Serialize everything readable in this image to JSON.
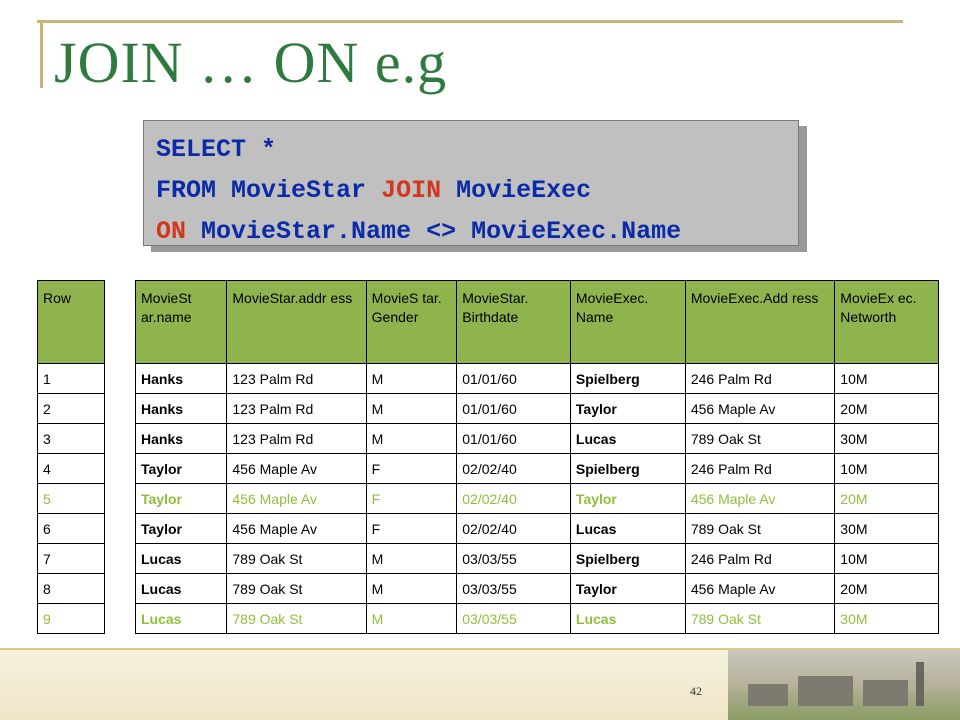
{
  "title": "JOIN … ON e.g",
  "sql": {
    "line1": "SELECT *",
    "line2": {
      "from": "FROM",
      "t1": "MovieStar",
      "join": "JOIN",
      "t2": "MovieExec"
    },
    "line3": {
      "on": "ON",
      "cond": "MovieStar.Name <> MovieExec.Name"
    }
  },
  "row_header": "Row",
  "rows": [
    "1",
    "2",
    "3",
    "4",
    "5",
    "6",
    "7",
    "8",
    "9"
  ],
  "headers": [
    "MovieSt ar.name",
    "MovieStar.addr ess",
    "MovieS tar. Gender",
    "MovieStar. Birthdate",
    "MovieExec. Name",
    "MovieExec.Add ress",
    "MovieEx ec. Networth"
  ],
  "data": [
    [
      "Hanks",
      "123 Palm Rd",
      "M",
      "01/01/60",
      "Spielberg",
      "246 Palm Rd",
      "10M"
    ],
    [
      "Hanks",
      "123 Palm Rd",
      "M",
      "01/01/60",
      "Taylor",
      "456 Maple Av",
      "20M"
    ],
    [
      "Hanks",
      "123 Palm Rd",
      "M",
      "01/01/60",
      "Lucas",
      "789 Oak St",
      "30M"
    ],
    [
      "Taylor",
      "456 Maple Av",
      "F",
      "02/02/40",
      "Spielberg",
      "246 Palm Rd",
      "10M"
    ],
    [
      "Taylor",
      "456 Maple Av",
      "F",
      "02/02/40",
      "Taylor",
      "456 Maple Av",
      "20M"
    ],
    [
      "Taylor",
      "456 Maple Av",
      "F",
      "02/02/40",
      "Lucas",
      "789 Oak St",
      "30M"
    ],
    [
      "Lucas",
      "789 Oak St",
      "M",
      "03/03/55",
      "Spielberg",
      "246 Palm Rd",
      "10M"
    ],
    [
      "Lucas",
      "789 Oak St",
      "M",
      "03/03/55",
      "Taylor",
      "456 Maple Av",
      "20M"
    ],
    [
      "Lucas",
      "789 Oak St",
      "M",
      "03/03/55",
      "Lucas",
      "789 Oak St",
      "30M"
    ]
  ],
  "highlight_rows": [
    4,
    8
  ],
  "page_number": "42",
  "colors": {
    "title": "#2f7a3f",
    "header_bg": "#8fb34d",
    "highlight_text": "#8fbf3a",
    "keyword_blue": "#0a2aa8",
    "keyword_red": "#d2381d"
  }
}
